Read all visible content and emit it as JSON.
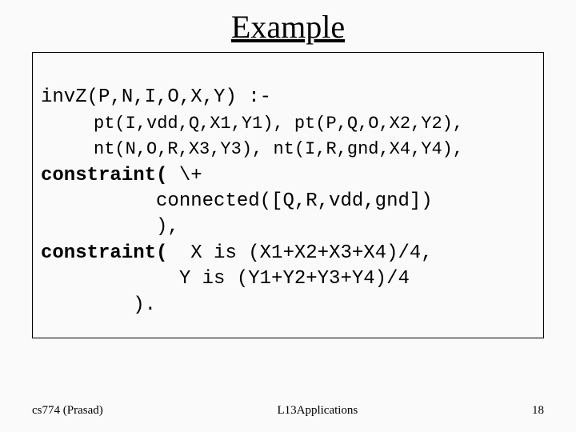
{
  "title": "Example",
  "code": {
    "l1": "invZ(P,N,I,O,X,Y) :-",
    "l2": "     pt(I,vdd,Q,X1,Y1), pt(P,Q,O,X2,Y2),",
    "l3": "     nt(N,O,R,X3,Y3), nt(I,R,gnd,X4,Y4),",
    "l4a": "constraint(",
    "l4b": " \\+",
    "l5": "          connected([Q,R,vdd,gnd])",
    "l6": "          ),",
    "l7a": "constraint(",
    "l7b": "  X is (X1+X2+X3+X4)/4,",
    "l8": "            Y is (Y1+Y2+Y3+Y4)/4",
    "l9": "        )."
  },
  "footer": {
    "left": "cs774 (Prasad)",
    "center": "L13Applications",
    "right": "18"
  }
}
